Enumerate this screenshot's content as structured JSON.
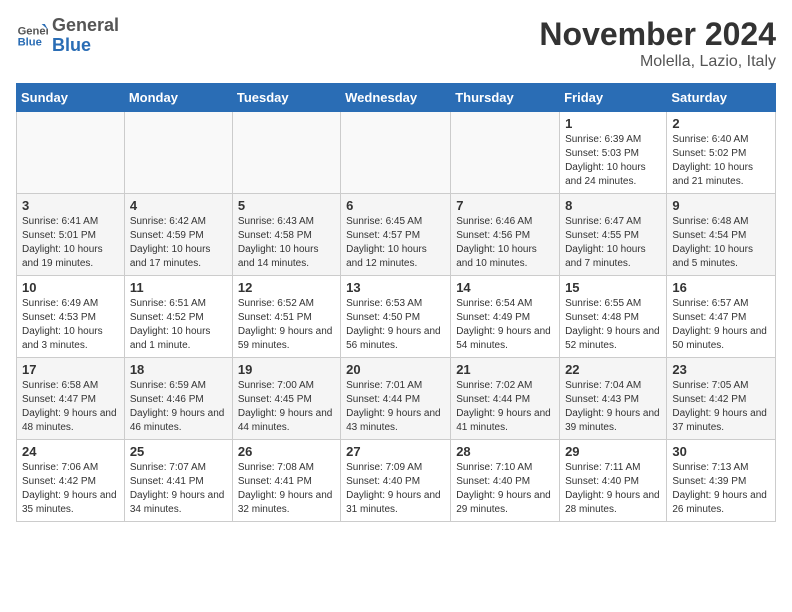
{
  "header": {
    "logo_line1": "General",
    "logo_line2": "Blue",
    "title": "November 2024",
    "subtitle": "Molella, Lazio, Italy"
  },
  "days_of_week": [
    "Sunday",
    "Monday",
    "Tuesday",
    "Wednesday",
    "Thursday",
    "Friday",
    "Saturday"
  ],
  "weeks": [
    [
      {
        "day": "",
        "info": ""
      },
      {
        "day": "",
        "info": ""
      },
      {
        "day": "",
        "info": ""
      },
      {
        "day": "",
        "info": ""
      },
      {
        "day": "",
        "info": ""
      },
      {
        "day": "1",
        "info": "Sunrise: 6:39 AM\nSunset: 5:03 PM\nDaylight: 10 hours and 24 minutes."
      },
      {
        "day": "2",
        "info": "Sunrise: 6:40 AM\nSunset: 5:02 PM\nDaylight: 10 hours and 21 minutes."
      }
    ],
    [
      {
        "day": "3",
        "info": "Sunrise: 6:41 AM\nSunset: 5:01 PM\nDaylight: 10 hours and 19 minutes."
      },
      {
        "day": "4",
        "info": "Sunrise: 6:42 AM\nSunset: 4:59 PM\nDaylight: 10 hours and 17 minutes."
      },
      {
        "day": "5",
        "info": "Sunrise: 6:43 AM\nSunset: 4:58 PM\nDaylight: 10 hours and 14 minutes."
      },
      {
        "day": "6",
        "info": "Sunrise: 6:45 AM\nSunset: 4:57 PM\nDaylight: 10 hours and 12 minutes."
      },
      {
        "day": "7",
        "info": "Sunrise: 6:46 AM\nSunset: 4:56 PM\nDaylight: 10 hours and 10 minutes."
      },
      {
        "day": "8",
        "info": "Sunrise: 6:47 AM\nSunset: 4:55 PM\nDaylight: 10 hours and 7 minutes."
      },
      {
        "day": "9",
        "info": "Sunrise: 6:48 AM\nSunset: 4:54 PM\nDaylight: 10 hours and 5 minutes."
      }
    ],
    [
      {
        "day": "10",
        "info": "Sunrise: 6:49 AM\nSunset: 4:53 PM\nDaylight: 10 hours and 3 minutes."
      },
      {
        "day": "11",
        "info": "Sunrise: 6:51 AM\nSunset: 4:52 PM\nDaylight: 10 hours and 1 minute."
      },
      {
        "day": "12",
        "info": "Sunrise: 6:52 AM\nSunset: 4:51 PM\nDaylight: 9 hours and 59 minutes."
      },
      {
        "day": "13",
        "info": "Sunrise: 6:53 AM\nSunset: 4:50 PM\nDaylight: 9 hours and 56 minutes."
      },
      {
        "day": "14",
        "info": "Sunrise: 6:54 AM\nSunset: 4:49 PM\nDaylight: 9 hours and 54 minutes."
      },
      {
        "day": "15",
        "info": "Sunrise: 6:55 AM\nSunset: 4:48 PM\nDaylight: 9 hours and 52 minutes."
      },
      {
        "day": "16",
        "info": "Sunrise: 6:57 AM\nSunset: 4:47 PM\nDaylight: 9 hours and 50 minutes."
      }
    ],
    [
      {
        "day": "17",
        "info": "Sunrise: 6:58 AM\nSunset: 4:47 PM\nDaylight: 9 hours and 48 minutes."
      },
      {
        "day": "18",
        "info": "Sunrise: 6:59 AM\nSunset: 4:46 PM\nDaylight: 9 hours and 46 minutes."
      },
      {
        "day": "19",
        "info": "Sunrise: 7:00 AM\nSunset: 4:45 PM\nDaylight: 9 hours and 44 minutes."
      },
      {
        "day": "20",
        "info": "Sunrise: 7:01 AM\nSunset: 4:44 PM\nDaylight: 9 hours and 43 minutes."
      },
      {
        "day": "21",
        "info": "Sunrise: 7:02 AM\nSunset: 4:44 PM\nDaylight: 9 hours and 41 minutes."
      },
      {
        "day": "22",
        "info": "Sunrise: 7:04 AM\nSunset: 4:43 PM\nDaylight: 9 hours and 39 minutes."
      },
      {
        "day": "23",
        "info": "Sunrise: 7:05 AM\nSunset: 4:42 PM\nDaylight: 9 hours and 37 minutes."
      }
    ],
    [
      {
        "day": "24",
        "info": "Sunrise: 7:06 AM\nSunset: 4:42 PM\nDaylight: 9 hours and 35 minutes."
      },
      {
        "day": "25",
        "info": "Sunrise: 7:07 AM\nSunset: 4:41 PM\nDaylight: 9 hours and 34 minutes."
      },
      {
        "day": "26",
        "info": "Sunrise: 7:08 AM\nSunset: 4:41 PM\nDaylight: 9 hours and 32 minutes."
      },
      {
        "day": "27",
        "info": "Sunrise: 7:09 AM\nSunset: 4:40 PM\nDaylight: 9 hours and 31 minutes."
      },
      {
        "day": "28",
        "info": "Sunrise: 7:10 AM\nSunset: 4:40 PM\nDaylight: 9 hours and 29 minutes."
      },
      {
        "day": "29",
        "info": "Sunrise: 7:11 AM\nSunset: 4:40 PM\nDaylight: 9 hours and 28 minutes."
      },
      {
        "day": "30",
        "info": "Sunrise: 7:13 AM\nSunset: 4:39 PM\nDaylight: 9 hours and 26 minutes."
      }
    ]
  ]
}
